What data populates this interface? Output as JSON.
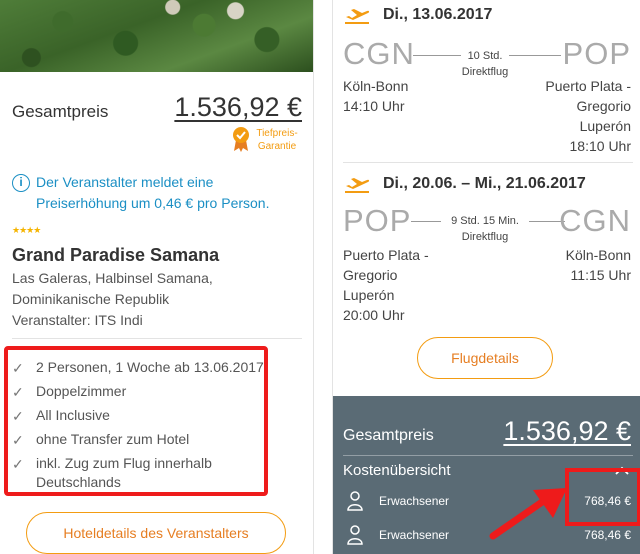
{
  "hotel": {
    "price_label": "Gesamtpreis",
    "price": "1.536,92 €",
    "badge_line1": "Tiefpreis-",
    "badge_line2": "Garantie",
    "info_icon": "info-icon",
    "info_text": "Der Veranstalter meldet eine Preiserhöhung um 0,46 € pro Person.",
    "stars": "★★★★",
    "star_count": 4,
    "name": "Grand Paradise Samana",
    "address_line1": "Las Galeras, Halbinsel Samana,",
    "address_line2": "Dominikanische Republik",
    "operator": "Veranstalter: ITS Indi",
    "features": [
      "2 Personen, 1 Woche ab 13.06.2017",
      "Doppelzimmer",
      "All Inclusive",
      "ohne Transfer zum Hotel",
      "inkl. Zug zum Flug innerhalb Deutschlands"
    ],
    "details_button": "Hoteldetails des Veranstalters"
  },
  "flights": {
    "outbound": {
      "date": "Di., 13.06.2017",
      "from_code": "CGN",
      "to_code": "POP",
      "duration": "10 Std.",
      "type": "Direktflug",
      "from_city": "Köln-Bonn",
      "from_time": "14:10 Uhr",
      "to_city_1": "Puerto Plata -",
      "to_city_2": "Gregorio",
      "to_city_3": "Luperón",
      "to_time": "18:10 Uhr"
    },
    "return": {
      "date": "Di., 20.06. – Mi., 21.06.2017",
      "from_code": "POP",
      "to_code": "CGN",
      "duration": "9 Std. 15 Min.",
      "type": "Direktflug",
      "from_city_1": "Puerto Plata -",
      "from_city_2": "Gregorio",
      "from_city_3": "Luperón",
      "from_time": "20:00 Uhr",
      "to_city": "Köln-Bonn",
      "to_time": "11:15 Uhr"
    },
    "details_button": "Flugdetails"
  },
  "summary": {
    "price_label": "Gesamtpreis",
    "price": "1.536,92 €",
    "cost_title": "Kostenübersicht",
    "toggle": "^",
    "passengers": [
      {
        "label": "Erwachsener",
        "price": "768,46 €"
      },
      {
        "label": "Erwachsener",
        "price": "768,46 €"
      }
    ]
  },
  "colors": {
    "accent": "#f39c12",
    "info": "#1b8fc4",
    "summary_bg": "#5a6b75",
    "highlight": "#ee1b1b"
  }
}
